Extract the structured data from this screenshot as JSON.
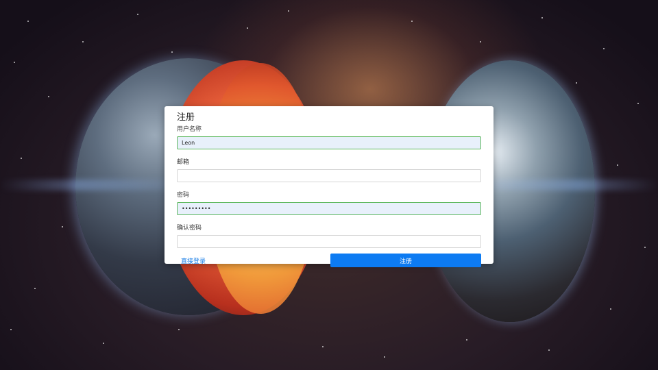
{
  "form": {
    "title": "注册",
    "fields": [
      {
        "label": "用户名称",
        "value": "Leon",
        "type": "text"
      },
      {
        "label": "邮箱",
        "value": "",
        "type": "email"
      },
      {
        "label": "密码",
        "value": "•••••••••",
        "type": "password"
      },
      {
        "label": "确认密码",
        "value": "",
        "type": "password"
      }
    ],
    "login_link": "直接登录",
    "submit_label": "注册"
  },
  "colors": {
    "accent": "#0d7bf2",
    "link": "#1a7ee6",
    "valid_border": "#5cb85c",
    "filled_bg": "#e8f0fb"
  }
}
